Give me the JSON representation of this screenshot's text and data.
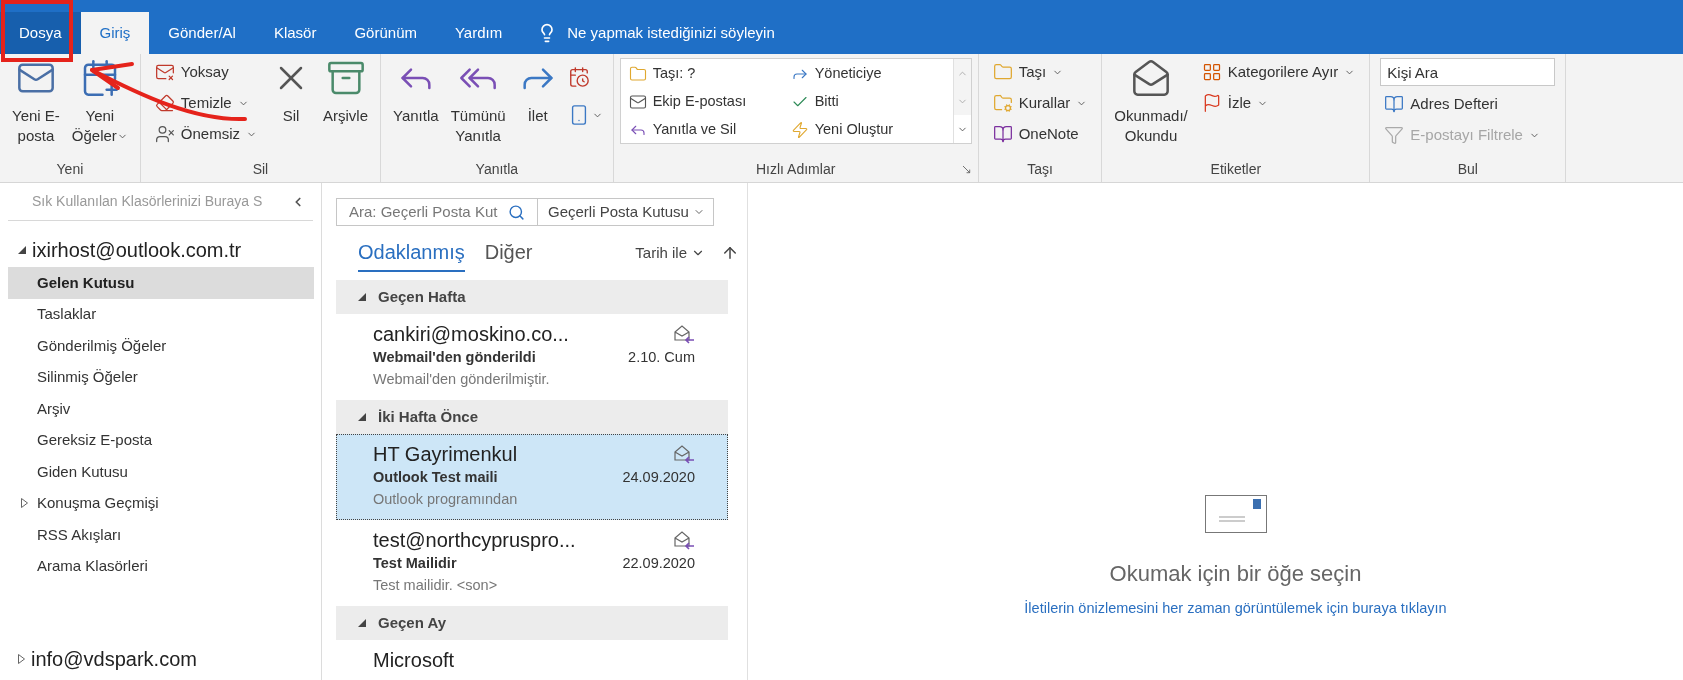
{
  "tabs": [
    {
      "label": "Dosya",
      "kind": "file",
      "selected": false
    },
    {
      "label": "Giriş",
      "kind": "tab",
      "selected": true
    },
    {
      "label": "Gönder/Al",
      "kind": "tab",
      "selected": false
    },
    {
      "label": "Klasör",
      "kind": "tab",
      "selected": false
    },
    {
      "label": "Görünüm",
      "kind": "tab",
      "selected": false
    },
    {
      "label": "Yardım",
      "kind": "tab",
      "selected": false
    }
  ],
  "tell_me": "Ne yapmak istediğinizi söyleyin",
  "ribbon": [
    {
      "label": "Yeni",
      "items": [
        {
          "kind": "large",
          "lines": [
            "Yeni E-",
            "posta"
          ]
        },
        {
          "kind": "large",
          "lines": [
            "Yeni",
            "Öğeler"
          ],
          "dropdown": true
        }
      ]
    },
    {
      "label": "Sil",
      "items": [
        {
          "kind": "stack",
          "entries": [
            {
              "label": "Yoksay",
              "dropdown": false,
              "disabled": false
            },
            {
              "label": "Temizle",
              "dropdown": true,
              "disabled": false
            },
            {
              "label": "Önemsiz",
              "dropdown": true,
              "disabled": false
            }
          ]
        },
        {
          "kind": "large",
          "lines": [
            "Sil"
          ]
        },
        {
          "kind": "large",
          "lines": [
            "Arşivle"
          ]
        }
      ]
    },
    {
      "label": "Yanıtla",
      "items": [
        {
          "kind": "large",
          "lines": [
            "Yanıtla"
          ]
        },
        {
          "kind": "large",
          "lines": [
            "Tümünü",
            "Yanıtla"
          ]
        },
        {
          "kind": "large",
          "lines": [
            "İlet"
          ]
        },
        {
          "kind": "icons",
          "entries": [
            {
              "dropdown": false
            },
            {
              "dropdown": true
            }
          ]
        }
      ]
    },
    {
      "label": "Hızlı Adımlar",
      "launcher": true,
      "items": [
        {
          "kind": "gallery",
          "entries": [
            {
              "label": "Taşı: ?"
            },
            {
              "label": "Yöneticiye"
            },
            {
              "label": "Ekip E-postası"
            },
            {
              "label": "Bitti"
            },
            {
              "label": "Yanıtla ve Sil"
            },
            {
              "label": "Yeni Oluştur"
            }
          ]
        }
      ]
    },
    {
      "label": "Taşı",
      "items": [
        {
          "kind": "stack",
          "entries": [
            {
              "label": "Taşı",
              "dropdown": true,
              "disabled": false
            },
            {
              "label": "Kurallar",
              "dropdown": true,
              "disabled": false
            },
            {
              "label": "OneNote",
              "dropdown": false,
              "disabled": false
            }
          ]
        }
      ]
    },
    {
      "label": "Etiketler",
      "items": [
        {
          "kind": "large",
          "lines": [
            "Okunmadı/",
            "Okundu"
          ]
        },
        {
          "kind": "stack",
          "entries": [
            {
              "label": "Kategorilere Ayır",
              "dropdown": true,
              "disabled": false
            },
            {
              "label": "İzle",
              "dropdown": true,
              "disabled": false
            }
          ]
        }
      ]
    },
    {
      "label": "Bul",
      "items": [
        {
          "kind": "search",
          "value": "Kişi Ara"
        },
        {
          "kind": "stack",
          "entries": [
            {
              "label": "Adres Defteri",
              "dropdown": false,
              "disabled": false
            },
            {
              "label": "E-postayı Filtrele",
              "dropdown": true,
              "disabled": true
            }
          ]
        }
      ]
    }
  ],
  "folder_pane": {
    "favorites_hint": "Sık Kullanılan Klasörlerinizi Buraya S",
    "accounts": [
      {
        "name": "ixirhost@outlook.com.tr",
        "expanded": true,
        "folders": [
          {
            "label": "Gelen Kutusu",
            "selected": true,
            "expandable": false
          },
          {
            "label": "Taslaklar",
            "selected": false,
            "expandable": false
          },
          {
            "label": "Gönderilmiş Öğeler",
            "selected": false,
            "expandable": false
          },
          {
            "label": "Silinmiş Öğeler",
            "selected": false,
            "expandable": false
          },
          {
            "label": "Arşiv",
            "selected": false,
            "expandable": false
          },
          {
            "label": "Gereksiz E-posta",
            "selected": false,
            "expandable": false
          },
          {
            "label": "Giden Kutusu",
            "selected": false,
            "expandable": false
          },
          {
            "label": "Konuşma Geçmişi",
            "selected": false,
            "expandable": true
          },
          {
            "label": "RSS Akışları",
            "selected": false,
            "expandable": false
          },
          {
            "label": "Arama Klasörleri",
            "selected": false,
            "expandable": false
          }
        ]
      },
      {
        "name": "info@vdspark.com",
        "expanded": false
      }
    ]
  },
  "message_list": {
    "search": {
      "placeholder": "Ara: Geçerli Posta Kut"
    },
    "scope": "Geçerli Posta Kutusu",
    "tabs": [
      {
        "label": "Odaklanmış",
        "selected": true
      },
      {
        "label": "Diğer",
        "selected": false
      }
    ],
    "sort": "Tarih ile",
    "groups": [
      {
        "label": "Geçen Hafta",
        "messages": [
          {
            "sender": "cankiri@moskino.co...",
            "subject": "Webmail'den gönderildi",
            "preview": "Webmail'den gönderilmiştir.",
            "date": "2.10. Cum",
            "selected": false
          }
        ]
      },
      {
        "label": "İki Hafta Önce",
        "messages": [
          {
            "sender": "HT Gayrimenkul",
            "subject": "Outlook Test maili",
            "preview": "Outlook programından",
            "date": "24.09.2020",
            "selected": true
          },
          {
            "sender": "test@northcypruspro...",
            "subject": "Test Mailidir",
            "preview": "Test mailidir. <son>",
            "date": "22.09.2020",
            "selected": false
          }
        ]
      },
      {
        "label": "Geçen Ay",
        "messages": [
          {
            "sender": "Microsoft",
            "selected": false
          }
        ]
      }
    ]
  },
  "reading_pane": {
    "title": "Okumak için bir öğe seçin",
    "link": "İletilerin önizlemesini her zaman görüntülemek için buraya tıklayın"
  }
}
